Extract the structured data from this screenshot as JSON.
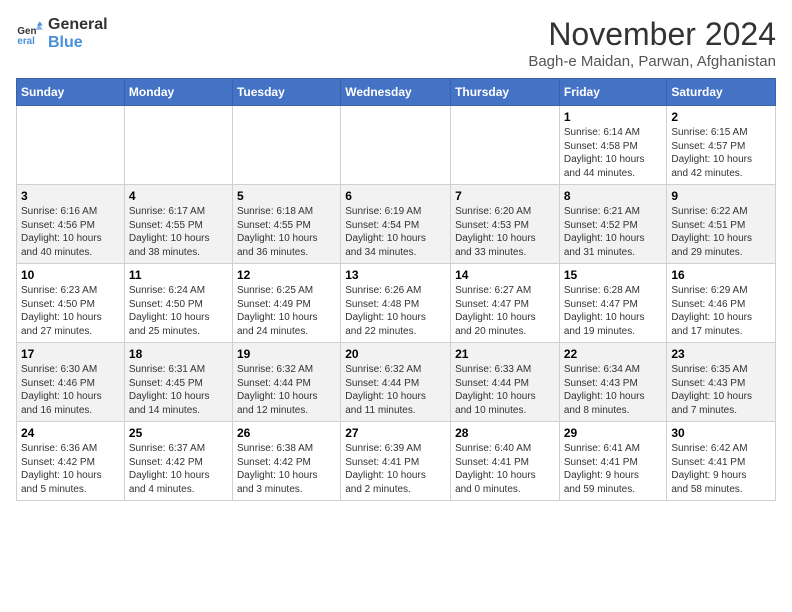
{
  "logo": {
    "line1": "General",
    "line2": "Blue"
  },
  "title": "November 2024",
  "subtitle": "Bagh-e Maidan, Parwan, Afghanistan",
  "headers": [
    "Sunday",
    "Monday",
    "Tuesday",
    "Wednesday",
    "Thursday",
    "Friday",
    "Saturday"
  ],
  "weeks": [
    [
      {
        "day": "",
        "detail": ""
      },
      {
        "day": "",
        "detail": ""
      },
      {
        "day": "",
        "detail": ""
      },
      {
        "day": "",
        "detail": ""
      },
      {
        "day": "",
        "detail": ""
      },
      {
        "day": "1",
        "detail": "Sunrise: 6:14 AM\nSunset: 4:58 PM\nDaylight: 10 hours\nand 44 minutes."
      },
      {
        "day": "2",
        "detail": "Sunrise: 6:15 AM\nSunset: 4:57 PM\nDaylight: 10 hours\nand 42 minutes."
      }
    ],
    [
      {
        "day": "3",
        "detail": "Sunrise: 6:16 AM\nSunset: 4:56 PM\nDaylight: 10 hours\nand 40 minutes."
      },
      {
        "day": "4",
        "detail": "Sunrise: 6:17 AM\nSunset: 4:55 PM\nDaylight: 10 hours\nand 38 minutes."
      },
      {
        "day": "5",
        "detail": "Sunrise: 6:18 AM\nSunset: 4:55 PM\nDaylight: 10 hours\nand 36 minutes."
      },
      {
        "day": "6",
        "detail": "Sunrise: 6:19 AM\nSunset: 4:54 PM\nDaylight: 10 hours\nand 34 minutes."
      },
      {
        "day": "7",
        "detail": "Sunrise: 6:20 AM\nSunset: 4:53 PM\nDaylight: 10 hours\nand 33 minutes."
      },
      {
        "day": "8",
        "detail": "Sunrise: 6:21 AM\nSunset: 4:52 PM\nDaylight: 10 hours\nand 31 minutes."
      },
      {
        "day": "9",
        "detail": "Sunrise: 6:22 AM\nSunset: 4:51 PM\nDaylight: 10 hours\nand 29 minutes."
      }
    ],
    [
      {
        "day": "10",
        "detail": "Sunrise: 6:23 AM\nSunset: 4:50 PM\nDaylight: 10 hours\nand 27 minutes."
      },
      {
        "day": "11",
        "detail": "Sunrise: 6:24 AM\nSunset: 4:50 PM\nDaylight: 10 hours\nand 25 minutes."
      },
      {
        "day": "12",
        "detail": "Sunrise: 6:25 AM\nSunset: 4:49 PM\nDaylight: 10 hours\nand 24 minutes."
      },
      {
        "day": "13",
        "detail": "Sunrise: 6:26 AM\nSunset: 4:48 PM\nDaylight: 10 hours\nand 22 minutes."
      },
      {
        "day": "14",
        "detail": "Sunrise: 6:27 AM\nSunset: 4:47 PM\nDaylight: 10 hours\nand 20 minutes."
      },
      {
        "day": "15",
        "detail": "Sunrise: 6:28 AM\nSunset: 4:47 PM\nDaylight: 10 hours\nand 19 minutes."
      },
      {
        "day": "16",
        "detail": "Sunrise: 6:29 AM\nSunset: 4:46 PM\nDaylight: 10 hours\nand 17 minutes."
      }
    ],
    [
      {
        "day": "17",
        "detail": "Sunrise: 6:30 AM\nSunset: 4:46 PM\nDaylight: 10 hours\nand 16 minutes."
      },
      {
        "day": "18",
        "detail": "Sunrise: 6:31 AM\nSunset: 4:45 PM\nDaylight: 10 hours\nand 14 minutes."
      },
      {
        "day": "19",
        "detail": "Sunrise: 6:32 AM\nSunset: 4:44 PM\nDaylight: 10 hours\nand 12 minutes."
      },
      {
        "day": "20",
        "detail": "Sunrise: 6:32 AM\nSunset: 4:44 PM\nDaylight: 10 hours\nand 11 minutes."
      },
      {
        "day": "21",
        "detail": "Sunrise: 6:33 AM\nSunset: 4:44 PM\nDaylight: 10 hours\nand 10 minutes."
      },
      {
        "day": "22",
        "detail": "Sunrise: 6:34 AM\nSunset: 4:43 PM\nDaylight: 10 hours\nand 8 minutes."
      },
      {
        "day": "23",
        "detail": "Sunrise: 6:35 AM\nSunset: 4:43 PM\nDaylight: 10 hours\nand 7 minutes."
      }
    ],
    [
      {
        "day": "24",
        "detail": "Sunrise: 6:36 AM\nSunset: 4:42 PM\nDaylight: 10 hours\nand 5 minutes."
      },
      {
        "day": "25",
        "detail": "Sunrise: 6:37 AM\nSunset: 4:42 PM\nDaylight: 10 hours\nand 4 minutes."
      },
      {
        "day": "26",
        "detail": "Sunrise: 6:38 AM\nSunset: 4:42 PM\nDaylight: 10 hours\nand 3 minutes."
      },
      {
        "day": "27",
        "detail": "Sunrise: 6:39 AM\nSunset: 4:41 PM\nDaylight: 10 hours\nand 2 minutes."
      },
      {
        "day": "28",
        "detail": "Sunrise: 6:40 AM\nSunset: 4:41 PM\nDaylight: 10 hours\nand 0 minutes."
      },
      {
        "day": "29",
        "detail": "Sunrise: 6:41 AM\nSunset: 4:41 PM\nDaylight: 9 hours\nand 59 minutes."
      },
      {
        "day": "30",
        "detail": "Sunrise: 6:42 AM\nSunset: 4:41 PM\nDaylight: 9 hours\nand 58 minutes."
      }
    ]
  ]
}
